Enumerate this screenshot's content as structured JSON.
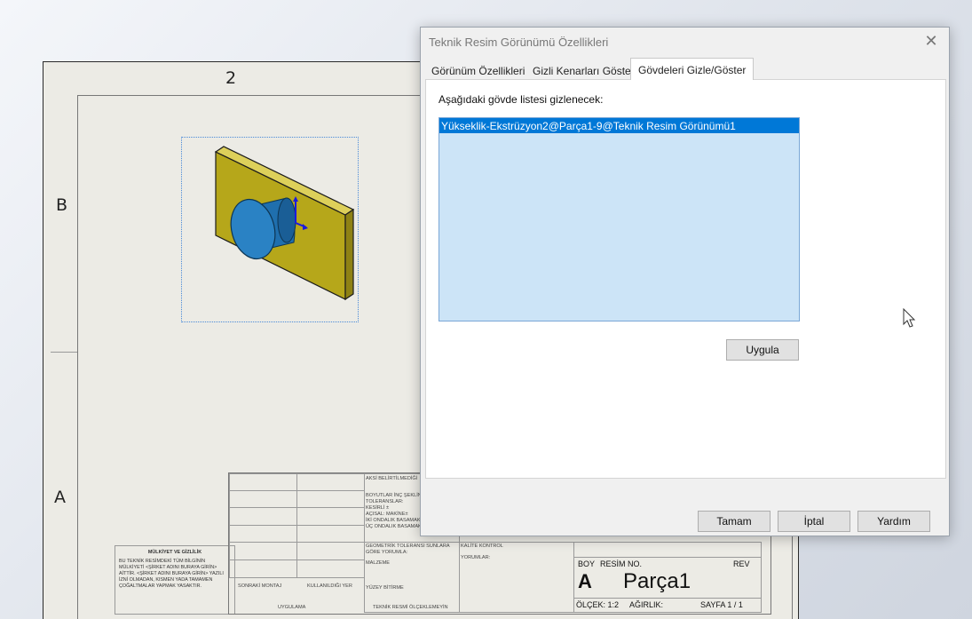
{
  "drawing": {
    "zone_column": "2",
    "zone_rows": [
      "B",
      "A"
    ],
    "title_block": {
      "left_header_cells": [
        "AKSİ BELİRTİLMEDİĞİ",
        "BOYUTLAR İNÇ ŞEKLİNDE",
        "TOLERANSLAR:",
        "KESİRLİ ±",
        "AÇISAL: MAKİNE±",
        "İKİ ONDALIK BASAMAK",
        "ÜÇ ONDALIK BASAMAK"
      ],
      "geometric_tolerance": "GEOMETRİK TOLERANSI SUNLARA GÖRE YORUMLA:",
      "material": "MALZEME",
      "surface_finish": "YÜZEY BİTİRME",
      "do_not_scale": "TEKNİK RESMİ ÖLÇEKLEMEYİN",
      "quality_control": "KALİTE KONTROL",
      "comments": "YORUMLAR:",
      "next_assembly": "SONRAKİ MONTAJ",
      "used_on": "KULLANILDIĞI YER",
      "application": "UYGULAMA",
      "size_label": "BOY",
      "size_value": "A",
      "dwg_no_label": "RESİM  NO.",
      "part_name": "Parça1",
      "rev_label": "REV",
      "scale_label": "ÖLÇEK: 1:2",
      "weight_label": "AĞIRLIK:",
      "sheet_label": "SAYFA 1 / 1"
    },
    "proprietary": {
      "heading": "MÜLKİYET VE GİZLİLİK",
      "body": "BU TEKNİK RESİMDEKİ TÜM BİLGİNİN MÜLKİYETİ <ŞİRKET ADINI BURAYA GİRİN> AİTTİR. <ŞİRKET ADINI BURAYA GİRİN> YAZILI İZNİ OLMADAN, KISMEN YADA TAMAMEN ÇOĞALTMALAR YAPMAK YASAKTIR."
    }
  },
  "dialog": {
    "title": "Teknik Resim Görünümü Özellikleri",
    "tabs": [
      {
        "label": "Görünüm Özellikleri",
        "active": false
      },
      {
        "label": "Gizli Kenarları Göster",
        "active": false
      },
      {
        "label": "Gövdeleri Gizle/Göster",
        "active": true
      }
    ],
    "list_label": "Aşağıdaki gövde listesi gizlenecek:",
    "hidden_bodies": [
      "Yükseklik-Ekstrüzyon2@Parça1-9@Teknik Resim Görünümü1"
    ],
    "apply_button": "Uygula",
    "ok_button": "Tamam",
    "cancel_button": "İptal",
    "help_button": "Yardım"
  },
  "colors": {
    "sheet": "#ecebe5",
    "plate": "#c8b820",
    "cylinder": "#1f6fae",
    "selection": "#0078d7",
    "listbox": "#cce4f7"
  }
}
